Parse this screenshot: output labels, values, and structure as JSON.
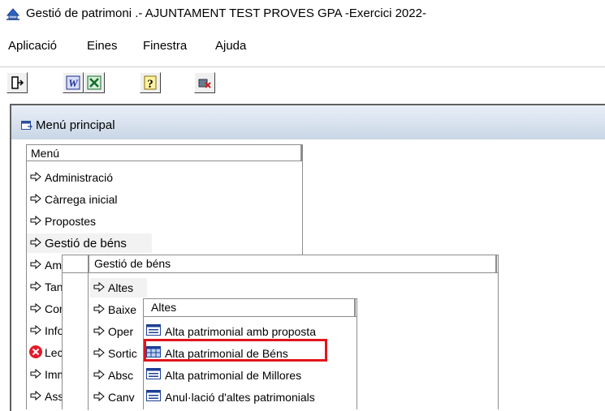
{
  "window": {
    "title": "Gestió de patrimoni .- AJUNTAMENT TEST PROVES GPA -Exercici 2022-"
  },
  "menubar": [
    "Aplicació",
    "Eines",
    "Finestra",
    "Ajuda"
  ],
  "toolbar": {
    "icons": [
      "exit-icon",
      "word-icon",
      "excel-icon",
      "help-icon",
      "tool-icon"
    ]
  },
  "child_window": {
    "title": "Menú principal"
  },
  "main_menu": {
    "header": "Menú",
    "items": [
      {
        "label": "Administració",
        "icon": "arrow-icon"
      },
      {
        "label": "Càrrega inicial",
        "icon": "arrow-icon"
      },
      {
        "label": "Propostes",
        "icon": "arrow-icon"
      },
      {
        "label": "Gestió de béns",
        "icon": "arrow-icon"
      },
      {
        "label": "Amor",
        "icon": "arrow-icon"
      },
      {
        "label": "Tanc",
        "icon": "arrow-icon"
      },
      {
        "label": "Cons",
        "icon": "arrow-icon"
      },
      {
        "label": "Inforr",
        "icon": "arrow-icon"
      },
      {
        "label": "Lecto",
        "icon": "error-icon"
      },
      {
        "label": "Immc",
        "icon": "arrow-icon"
      },
      {
        "label": "Asse",
        "icon": "arrow-icon"
      }
    ]
  },
  "submenu_bens": {
    "header": "Gestió de béns",
    "items": [
      {
        "label": "Altes"
      },
      {
        "label": "Baixe"
      },
      {
        "label": "Oper"
      },
      {
        "label": "Sortic"
      },
      {
        "label": "Absc"
      },
      {
        "label": "Canv"
      }
    ]
  },
  "submenu_altes": {
    "header": "Altes",
    "items": [
      {
        "label": "Alta patrimonial amb proposta"
      },
      {
        "label": "Alta patrimonial de Béns"
      },
      {
        "label": "Alta patrimonial de Millores"
      },
      {
        "label": "Anul·lació d'altes patrimonials"
      }
    ],
    "highlight_color": "#e2141b"
  },
  "colors": {
    "title_gradient_top": "#e9eff7",
    "title_gradient_bottom": "#c9d6e6",
    "border": "#8c8c8c"
  }
}
